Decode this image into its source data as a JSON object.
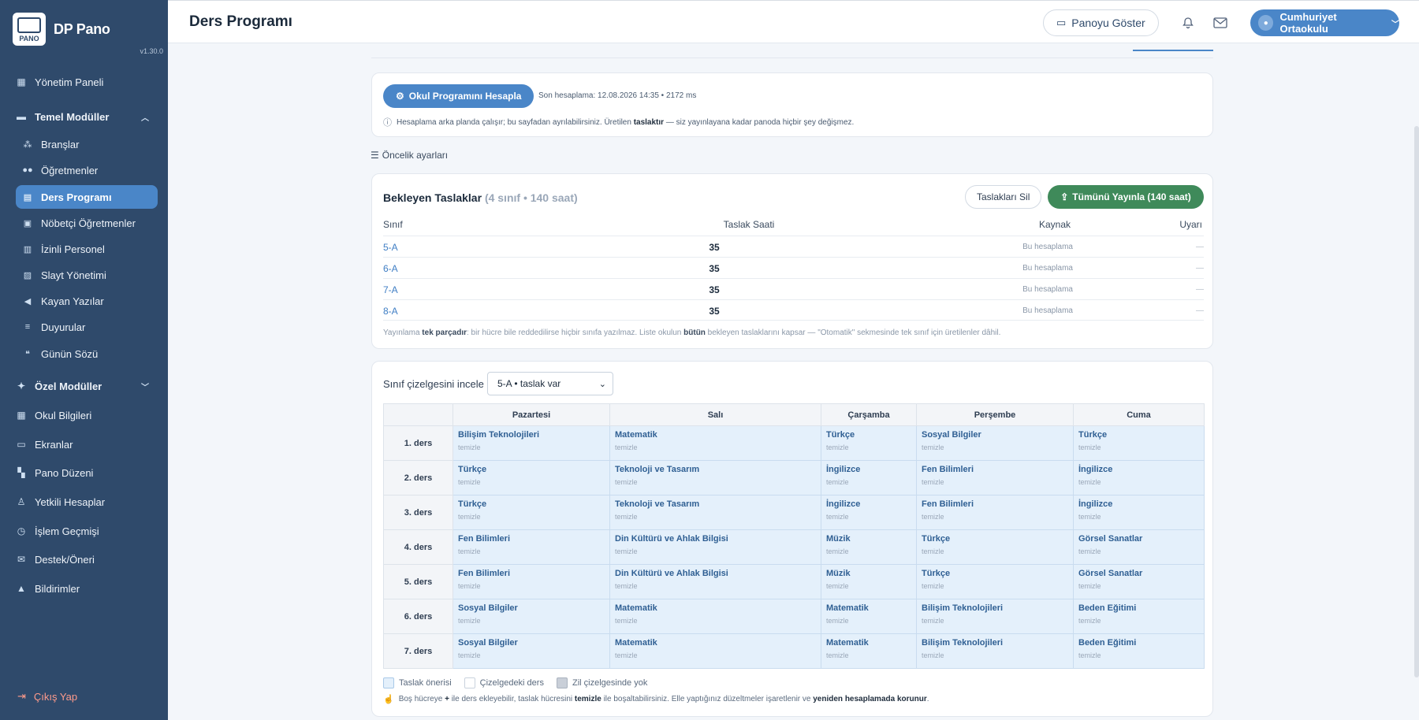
{
  "app": {
    "logo_text": "PANO",
    "name": "DP Pano",
    "version": "v1.30.0"
  },
  "sidebar": {
    "items": [
      {
        "label": "Yönetim Paneli"
      },
      {
        "label": "Temel Modüller"
      },
      {
        "label": "Branşlar"
      },
      {
        "label": "Öğretmenler"
      },
      {
        "label": "Ders Programı"
      },
      {
        "label": "Nöbetçi Öğretmenler"
      },
      {
        "label": "İzinli Personel"
      },
      {
        "label": "Slayt Yönetimi"
      },
      {
        "label": "Kayan Yazılar"
      },
      {
        "label": "Duyurular"
      },
      {
        "label": "Günün Sözü"
      },
      {
        "label": "Özel Modüller"
      },
      {
        "label": "Okul Bilgileri"
      },
      {
        "label": "Ekranlar"
      },
      {
        "label": "Pano Düzeni"
      },
      {
        "label": "Yetkili Hesaplar"
      },
      {
        "label": "İşlem Geçmişi"
      },
      {
        "label": "Destek/Öneri"
      },
      {
        "label": "Bildirimler"
      }
    ],
    "logout": "Çıkış Yap"
  },
  "header": {
    "title": "Ders Programı",
    "show_board": "Panoyu Göster",
    "school": "Cumhuriyet Ortaokulu"
  },
  "calc": {
    "button": "Okul Programını Hesapla",
    "last": "Son hesaplama: 12.08.2026 14:35 • 2172 ms",
    "note_pre": "Hesaplama arka planda çalışır; bu sayfadan ayrılabilirsiniz. Üretilen ",
    "note_bold": "taslaktır",
    "note_post": " — siz yayınlayana kadar panoda hiçbir şey değişmez."
  },
  "priority_label": "Öncelik ayarları",
  "drafts": {
    "title": "Bekleyen Taslaklar",
    "subtitle": "(4 sınıf • 140 saat)",
    "delete_btn": "Taslakları Sil",
    "publish_btn": "Tümünü Yayınla (140 saat)",
    "columns": [
      "Sınıf",
      "Taslak Saati",
      "Kaynak",
      "Uyarı"
    ],
    "rows": [
      {
        "class": "5-A",
        "hours": "35",
        "source": "Bu hesaplama",
        "warn": "—"
      },
      {
        "class": "6-A",
        "hours": "35",
        "source": "Bu hesaplama",
        "warn": "—"
      },
      {
        "class": "7-A",
        "hours": "35",
        "source": "Bu hesaplama",
        "warn": "—"
      },
      {
        "class": "8-A",
        "hours": "35",
        "source": "Bu hesaplama",
        "warn": "—"
      }
    ],
    "foot_1": "Yayınlama ",
    "foot_b1": "tek parçadır",
    "foot_2": ": bir hücre bile reddedilirse hiçbir sınıfa yazılmaz. Liste okulun ",
    "foot_b2": "bütün",
    "foot_3": " bekleyen taslaklarını kapsar — \"Otomatik\" sekmesinde tek sınıf için üretilenler dâhil."
  },
  "schedule": {
    "label": "Sınıf çizelgesini incele",
    "selected": "5-A • taslak var",
    "days": [
      "Pazartesi",
      "Salı",
      "Çarşamba",
      "Perşembe",
      "Cuma"
    ],
    "clear_label": "temizle",
    "periods": [
      {
        "label": "1. ders",
        "cells": [
          "Bilişim Teknolojileri",
          "Matematik",
          "Türkçe",
          "Sosyal Bilgiler",
          "Türkçe"
        ]
      },
      {
        "label": "2. ders",
        "cells": [
          "Türkçe",
          "Teknoloji ve Tasarım",
          "İngilizce",
          "Fen Bilimleri",
          "İngilizce"
        ]
      },
      {
        "label": "3. ders",
        "cells": [
          "Türkçe",
          "Teknoloji ve Tasarım",
          "İngilizce",
          "Fen Bilimleri",
          "İngilizce"
        ]
      },
      {
        "label": "4. ders",
        "cells": [
          "Fen Bilimleri",
          "Din Kültürü ve Ahlak Bilgisi",
          "Müzik",
          "Türkçe",
          "Görsel Sanatlar"
        ]
      },
      {
        "label": "5. ders",
        "cells": [
          "Fen Bilimleri",
          "Din Kültürü ve Ahlak Bilgisi",
          "Müzik",
          "Türkçe",
          "Görsel Sanatlar"
        ]
      },
      {
        "label": "6. ders",
        "cells": [
          "Sosyal Bilgiler",
          "Matematik",
          "Matematik",
          "Bilişim Teknolojileri",
          "Beden Eğitimi"
        ]
      },
      {
        "label": "7. ders",
        "cells": [
          "Sosyal Bilgiler",
          "Matematik",
          "Matematik",
          "Bilişim Teknolojileri",
          "Beden Eğitimi"
        ]
      }
    ],
    "legend": [
      "Taslak önerisi",
      "Çizelgedeki ders",
      "Zil çizelgesinde yok"
    ],
    "legend_colors": [
      "#e4f0fb",
      "#ffffff",
      "#c9cfd8"
    ],
    "foot_1": "Boş hücreye ",
    "foot_b1": "+",
    "foot_2": " ile ders ekleyebilir, taslak hücresini ",
    "foot_b2": "temizle",
    "foot_3": " ile boşaltabilirsiniz. Elle yaptığınız düzeltmeler işaretlenir ve ",
    "foot_b3": "yeniden hesaplamada korunur",
    "foot_4": "."
  },
  "colors": {
    "sidebar": "#2f4a6b",
    "accent": "#4a86c8",
    "publish": "#3f8a5a",
    "logout": "#ff9b8b"
  }
}
